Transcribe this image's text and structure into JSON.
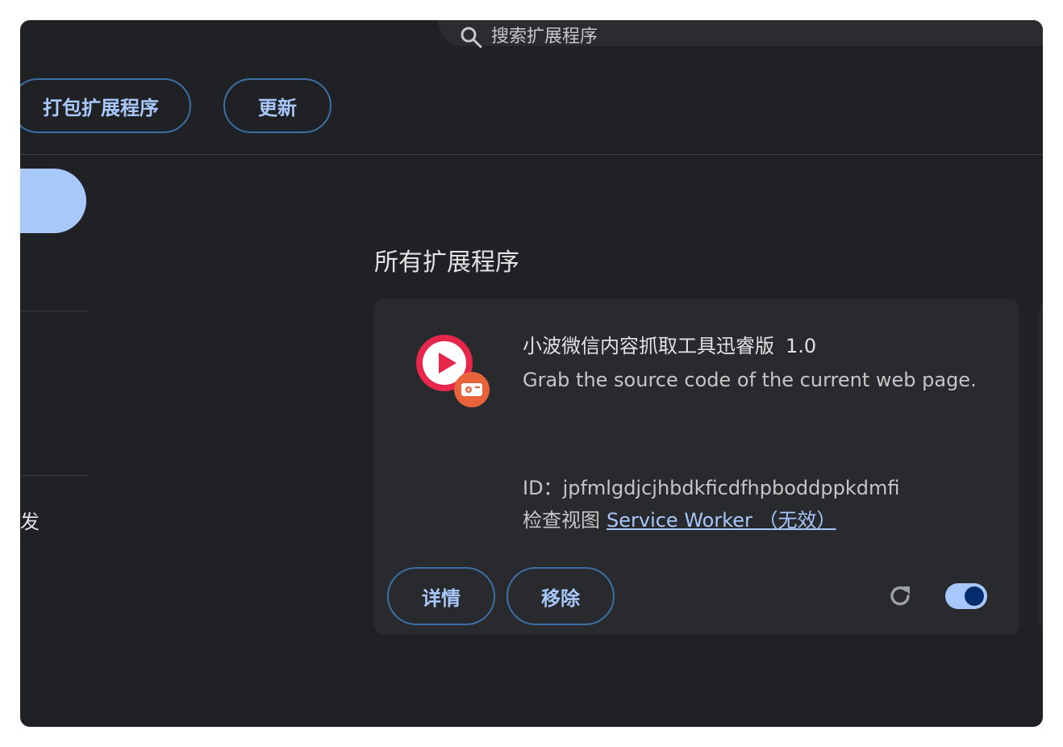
{
  "search": {
    "placeholder": "搜索扩展程序",
    "icon": "search-icon"
  },
  "toolbar": {
    "pack_label": "打包扩展程序",
    "update_label": "更新"
  },
  "sidebar": {
    "partial_item_label": "发"
  },
  "main": {
    "section_title": "所有扩展程序"
  },
  "extension": {
    "name": "小波微信内容抓取工具迅睿版",
    "version": "1.0",
    "description": "Grab the source code of the current web page.",
    "id_label": "ID：",
    "id_value": "jpfmlgdjcjhbdkficdfhpboddppkdmfi",
    "inspect_label": "检查视图",
    "inspect_link": "Service Worker （无效）",
    "details_label": "详情",
    "remove_label": "移除",
    "enabled": true
  },
  "colors": {
    "window_bg": "#202124",
    "card_bg": "#292a2d",
    "accent": "#a8c7fa",
    "button_border": "#3c6fa3",
    "icon_red": "#e6264b",
    "badge_orange": "#e8623a"
  }
}
